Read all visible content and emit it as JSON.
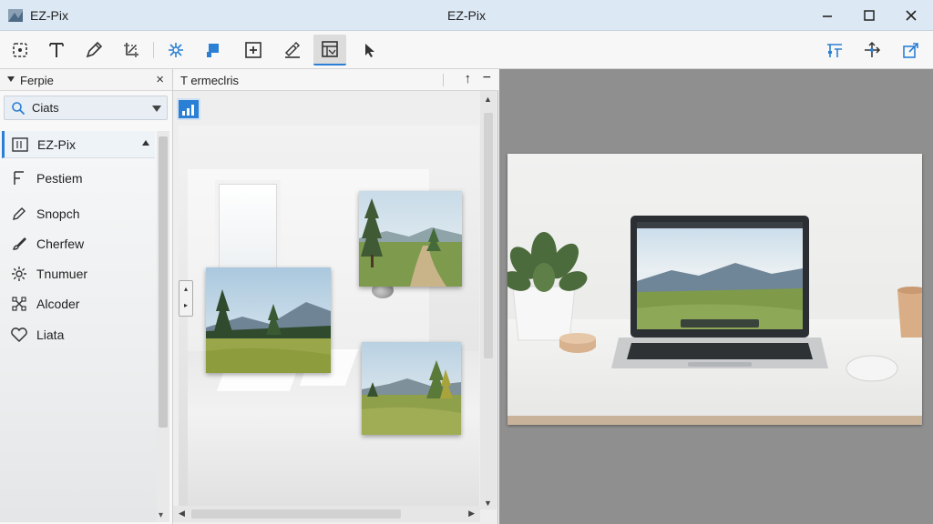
{
  "window": {
    "app_name": "EZ-Pix",
    "title": "EZ-Pix",
    "controls": [
      "minimize-icon",
      "maximize-icon",
      "close-icon"
    ]
  },
  "toolbar": {
    "tools": [
      {
        "icon": "crop-select-icon"
      },
      {
        "icon": "text-icon"
      },
      {
        "icon": "pencil-icon"
      },
      {
        "icon": "transform-icon"
      },
      {
        "icon": "sparkle-effects-icon"
      },
      {
        "icon": "flag-marker-icon"
      },
      {
        "icon": "add-layer-icon"
      },
      {
        "icon": "signature-icon"
      },
      {
        "icon": "layout-icon",
        "active": true
      },
      {
        "icon": "pointer-icon"
      }
    ],
    "right_tools": [
      {
        "icon": "adjust-icon"
      },
      {
        "icon": "move-icon"
      },
      {
        "icon": "export-icon"
      }
    ],
    "accent": "#2b7fd4"
  },
  "left_panel": {
    "title": "Ferpie",
    "close": "×",
    "search": {
      "value": "Ciats"
    },
    "tree": {
      "header": "EZ-Pix",
      "items": [
        {
          "label": "Pestiem",
          "icon": "frame-icon"
        },
        {
          "label": "Snopch",
          "icon": "pencil-icon"
        },
        {
          "label": "Cherfew",
          "icon": "brush-icon"
        },
        {
          "label": "Tnumuer",
          "icon": "gear-icon"
        },
        {
          "label": "Alcoder",
          "icon": "nodes-icon"
        },
        {
          "label": "Liata",
          "icon": "heart-icon"
        }
      ]
    }
  },
  "middle_panel": {
    "title": "T ermeclris",
    "up": "↑",
    "minimize": "−"
  },
  "right_panel": {
    "background": "#8f8f8f"
  }
}
